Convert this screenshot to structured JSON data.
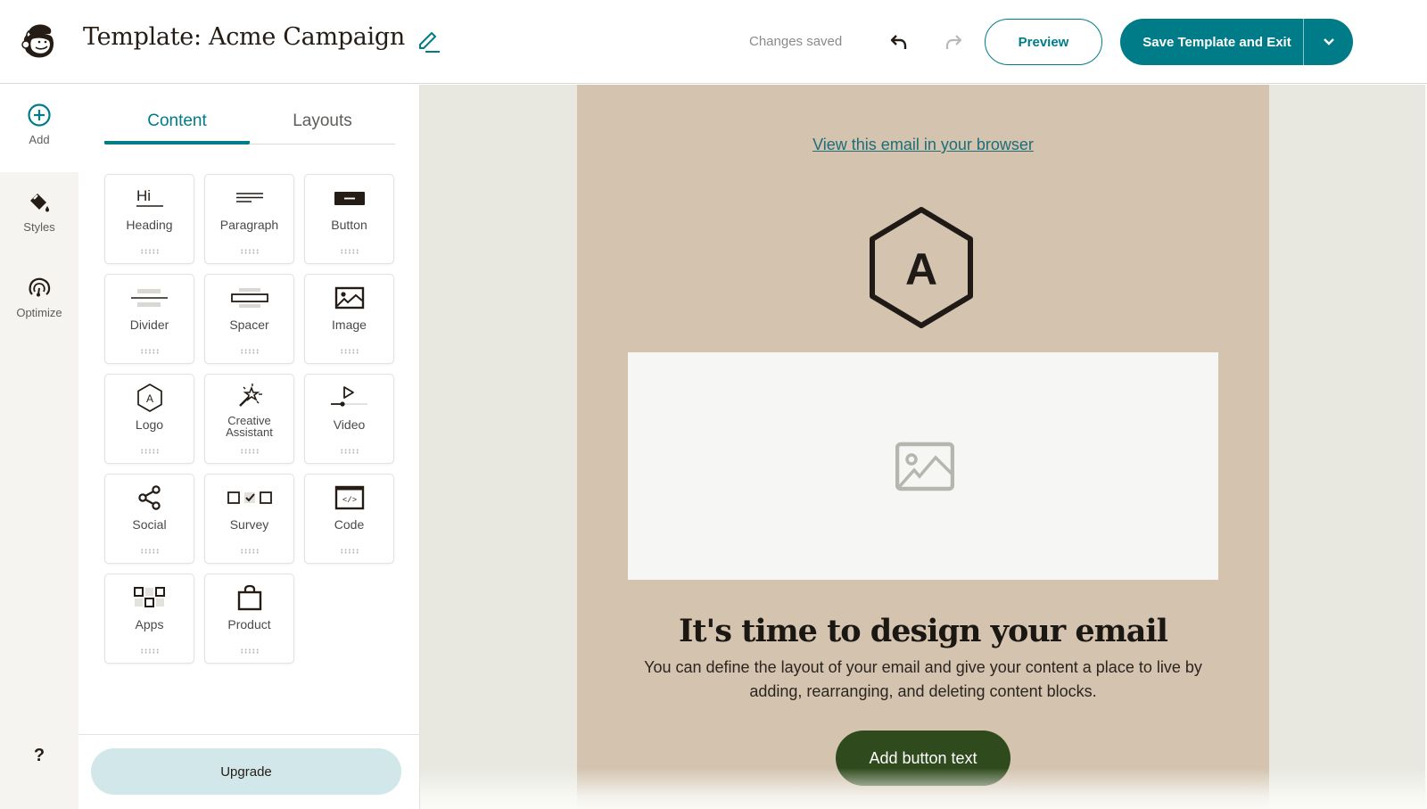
{
  "header": {
    "logo_icon": "mailchimp-freddie-logo",
    "title": "Template: Acme Campaign",
    "edit_icon": "pencil-icon",
    "status": "Changes saved",
    "undo_icon": "undo-icon",
    "redo_icon": "redo-icon",
    "preview_label": "Preview",
    "save_label": "Save Template and Exit",
    "save_menu_icon": "chevron-down-icon"
  },
  "rail": {
    "items": [
      {
        "label": "Add",
        "icon": "plus-circle-icon",
        "active": true
      },
      {
        "label": "Styles",
        "icon": "paint-bucket-icon",
        "active": false
      },
      {
        "label": "Optimize",
        "icon": "gauge-icon",
        "active": false
      }
    ],
    "help_label": "?"
  },
  "panel": {
    "tabs": [
      {
        "label": "Content",
        "active": true
      },
      {
        "label": "Layouts",
        "active": false
      }
    ],
    "blocks": [
      {
        "label": "Heading",
        "icon": "heading-icon"
      },
      {
        "label": "Paragraph",
        "icon": "paragraph-icon"
      },
      {
        "label": "Button",
        "icon": "button-icon"
      },
      {
        "label": "Divider",
        "icon": "divider-icon"
      },
      {
        "label": "Spacer",
        "icon": "spacer-icon"
      },
      {
        "label": "Image",
        "icon": "image-icon"
      },
      {
        "label": "Logo",
        "icon": "logo-hexagon-icon"
      },
      {
        "label": "Creative Assistant",
        "icon": "magic-wand-icon"
      },
      {
        "label": "Video",
        "icon": "video-icon"
      },
      {
        "label": "Social",
        "icon": "share-icon"
      },
      {
        "label": "Survey",
        "icon": "survey-icon"
      },
      {
        "label": "Code",
        "icon": "code-icon"
      },
      {
        "label": "Apps",
        "icon": "apps-icon"
      },
      {
        "label": "Product",
        "icon": "shopping-bag-icon"
      }
    ],
    "upgrade_label": "Upgrade"
  },
  "email": {
    "view_in_browser": "View this email in your browser",
    "logo_letter": "A",
    "image_placeholder_icon": "image-placeholder-icon",
    "heading": "It's time to design your email",
    "body": "You can define the layout of your email and give your content a place to live by adding, rearranging, and deleting content blocks.",
    "button_text": "Add button text"
  },
  "colors": {
    "brand_teal": "#007c89",
    "email_background": "#d3c3af",
    "canvas_background": "#e8e8e1",
    "cta_green": "#2f4a1c",
    "upgrade_background": "#d1e7ea"
  }
}
